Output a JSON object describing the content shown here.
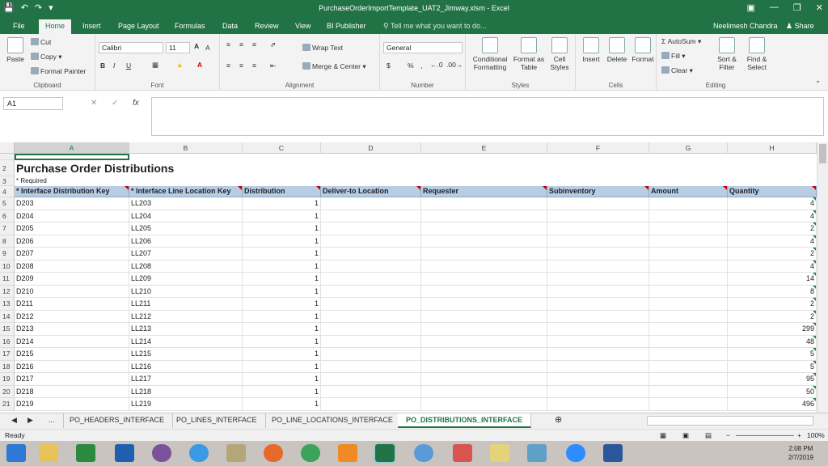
{
  "window": {
    "title": "PurchaseOrderImportTemplate_UAT2_Jimway.xlsm - Excel",
    "qat_icons": [
      "save-icon",
      "undo-icon",
      "redo-icon",
      "customize-icon"
    ]
  },
  "tabs": [
    "File",
    "Home",
    "Insert",
    "Page Layout",
    "Formulas",
    "Data",
    "Review",
    "View",
    "BI Publisher"
  ],
  "active_tab": "Home",
  "tell_me": "Tell me what you want to do...",
  "user": "Neelimesh Chandra",
  "share": "Share",
  "ribbon": {
    "clipboard": {
      "label": "Clipboard",
      "paste": "Paste",
      "cut": "Cut",
      "copy": "Copy",
      "format_painter": "Format Painter"
    },
    "font": {
      "label": "Font",
      "name": "Calibri",
      "size": "11",
      "bold": "B",
      "italic": "I",
      "underline": "U",
      "grow": "A",
      "shrink": "A"
    },
    "alignment": {
      "label": "Alignment",
      "wrap": "Wrap Text",
      "merge": "Merge & Center"
    },
    "number": {
      "label": "Number",
      "format": "General",
      "currency": "$",
      "percent": "%",
      "comma": ","
    },
    "styles": {
      "label": "Styles",
      "cond": "Conditional Formatting",
      "table": "Format as Table",
      "cell": "Cell Styles"
    },
    "cells": {
      "label": "Cells",
      "insert": "Insert",
      "delete": "Delete",
      "format": "Format"
    },
    "editing": {
      "label": "Editing",
      "autosum": "AutoSum",
      "fill": "Fill",
      "clear": "Clear",
      "sort": "Sort & Filter",
      "find": "Find & Select"
    }
  },
  "formula": {
    "name_box": "A1",
    "fx": "fx",
    "value": ""
  },
  "columns": [
    "A",
    "B",
    "C",
    "D",
    "E",
    "F",
    "G",
    "H"
  ],
  "sheet": {
    "title": "Purchase Order Distributions",
    "required_note": "* Required",
    "headers": [
      "* Interface Distribution Key",
      "* Interface Line Location Key",
      "Distribution",
      "Deliver-to Location",
      "Requester",
      "Subinventory",
      "Amount",
      "Quantity"
    ],
    "rows": [
      {
        "r": "5",
        "a": "D203",
        "b": "LL203",
        "c": "1",
        "h": "4"
      },
      {
        "r": "6",
        "a": "D204",
        "b": "LL204",
        "c": "1",
        "h": "4"
      },
      {
        "r": "7",
        "a": "D205",
        "b": "LL205",
        "c": "1",
        "h": "2"
      },
      {
        "r": "8",
        "a": "D206",
        "b": "LL206",
        "c": "1",
        "h": "4"
      },
      {
        "r": "9",
        "a": "D207",
        "b": "LL207",
        "c": "1",
        "h": "2"
      },
      {
        "r": "10",
        "a": "D208",
        "b": "LL208",
        "c": "1",
        "h": "4"
      },
      {
        "r": "11",
        "a": "D209",
        "b": "LL209",
        "c": "1",
        "h": "14"
      },
      {
        "r": "12",
        "a": "D210",
        "b": "LL210",
        "c": "1",
        "h": "8"
      },
      {
        "r": "13",
        "a": "D211",
        "b": "LL211",
        "c": "1",
        "h": "2"
      },
      {
        "r": "14",
        "a": "D212",
        "b": "LL212",
        "c": "1",
        "h": "2"
      },
      {
        "r": "15",
        "a": "D213",
        "b": "LL213",
        "c": "1",
        "h": "299"
      },
      {
        "r": "16",
        "a": "D214",
        "b": "LL214",
        "c": "1",
        "h": "48"
      },
      {
        "r": "17",
        "a": "D215",
        "b": "LL215",
        "c": "1",
        "h": "5"
      },
      {
        "r": "18",
        "a": "D216",
        "b": "LL216",
        "c": "1",
        "h": "5"
      },
      {
        "r": "19",
        "a": "D217",
        "b": "LL217",
        "c": "1",
        "h": "95"
      },
      {
        "r": "20",
        "a": "D218",
        "b": "LL218",
        "c": "1",
        "h": "50"
      },
      {
        "r": "21",
        "a": "D219",
        "b": "LL219",
        "c": "1",
        "h": "496"
      }
    ]
  },
  "sheet_tabs": [
    "...",
    "PO_HEADERS_INTERFACE",
    "PO_LINES_INTERFACE",
    "PO_LINE_LOCATIONS_INTERFACE",
    "PO_DISTRIBUTIONS_INTERFACE"
  ],
  "active_sheet": "PO_DISTRIBUTIONS_INTERFACE",
  "status": {
    "ready": "Ready",
    "zoom": "100%"
  },
  "taskbar": {
    "time": "2:08 PM",
    "date": "2/7/2019",
    "icons": [
      "start-icon",
      "file-explorer-icon",
      "store-icon",
      "outlook-icon",
      "viber-icon",
      "ie-icon",
      "app-icon",
      "firefox-icon",
      "chrome-icon",
      "uc-browser-icon",
      "excel-icon",
      "network-icon",
      "notes-icon",
      "files-icon",
      "zoom-icon",
      "word-icon"
    ]
  }
}
